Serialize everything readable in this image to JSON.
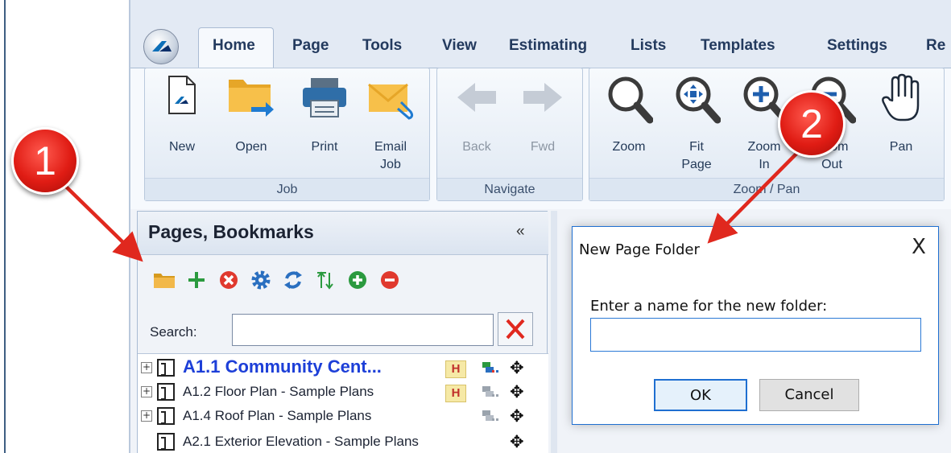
{
  "ribbon": {
    "tabs": [
      "Home",
      "Page",
      "Tools",
      "View",
      "Estimating",
      "Lists",
      "Templates",
      "Settings",
      "Re"
    ],
    "groups": {
      "job": {
        "label": "Job",
        "buttons": {
          "new": "New",
          "open": "Open",
          "print": "Print",
          "email_job_1": "Email",
          "email_job_2": "Job"
        }
      },
      "navigate": {
        "label": "Navigate",
        "buttons": {
          "back": "Back",
          "fwd": "Fwd"
        }
      },
      "zoom_pan": {
        "label": "Zoom / Pan",
        "buttons": {
          "zoom": "Zoom",
          "fit_page_1": "Fit",
          "fit_page_2": "Page",
          "zoom_in_1": "Zoom",
          "zoom_in_2": "In",
          "zoom_out_1": "Zoom",
          "zoom_out_2": "Out",
          "pan": "Pan"
        }
      }
    }
  },
  "panel": {
    "title": "Pages, Bookmarks",
    "collapse": "«",
    "search_label": "Search:",
    "search_value": "",
    "tree": [
      {
        "label": "A1.1 Community Cent...",
        "bold": true
      },
      {
        "label": "A1.2 Floor Plan - Sample Plans",
        "bold": false
      },
      {
        "label": "A1.4 Roof Plan - Sample Plans",
        "bold": false
      },
      {
        "label": "A2.1 Exterior Elevation - Sample Plans",
        "bold": false
      }
    ],
    "h_marker": "H"
  },
  "dialog": {
    "title": "New Page Folder",
    "close": "X",
    "prompt": "Enter a name for the new folder:",
    "input_value": "",
    "ok": "OK",
    "cancel": "Cancel"
  },
  "callouts": {
    "one": "1",
    "two": "2"
  },
  "colors": {
    "accent_blue": "#1d3fd8",
    "callout_red": "#e01c14",
    "ribbon_bg": "#e3eaf4"
  }
}
